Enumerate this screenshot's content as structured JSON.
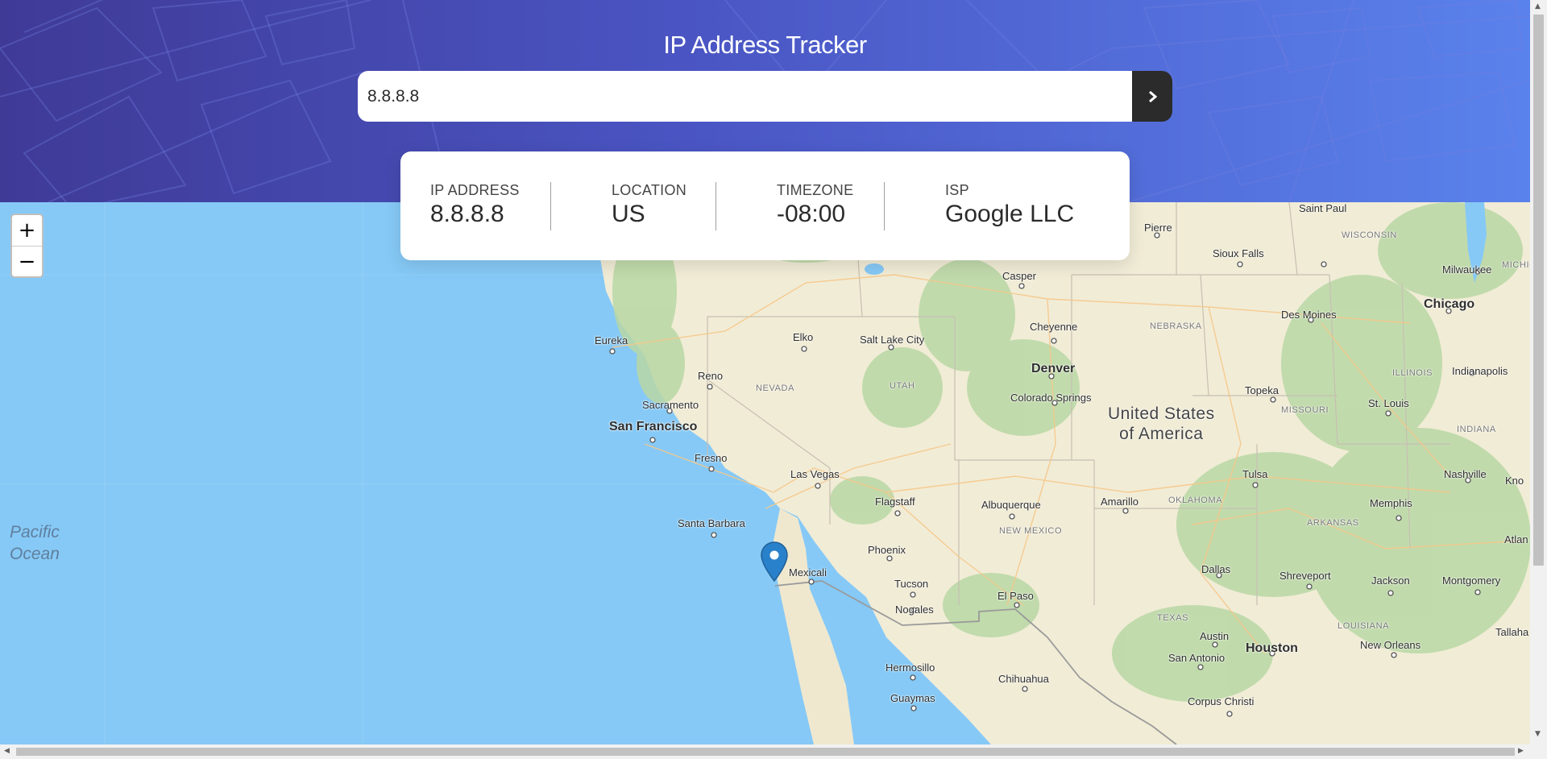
{
  "app": {
    "title": "IP Address Tracker"
  },
  "search": {
    "value": "8.8.8.8",
    "button_icon": "chevron-right-icon"
  },
  "info": [
    {
      "label": "IP ADDRESS",
      "value": "8.8.8.8"
    },
    {
      "label": "LOCATION",
      "value": "US"
    },
    {
      "label": "TIMEZONE",
      "value": "-08:00"
    },
    {
      "label": "ISP",
      "value": "Google LLC"
    }
  ],
  "map": {
    "zoom_in_label": "+",
    "zoom_out_label": "−",
    "marker_icon": "map-pin-icon",
    "labels": {
      "saint_paul": "Saint Paul",
      "pierre": "Pierre",
      "sioux_falls": "Sioux Falls",
      "casper": "Casper",
      "milwaukee": "Milwaukee",
      "chicago": "Chicago",
      "des_moines": "Des Moines",
      "eureka": "Eureka",
      "elko": "Elko",
      "salt_lake_city": "Salt Lake City",
      "cheyenne": "Cheyenne",
      "reno": "Reno",
      "denver": "Denver",
      "sacramento": "Sacramento",
      "colorado_springs": "Colorado Springs",
      "san_francisco": "San Francisco",
      "topeka": "Topeka",
      "st_louis": "St. Louis",
      "indianapolis": "Indianapolis",
      "fresno": "Fresno",
      "las_vegas": "Las Vegas",
      "tulsa": "Tulsa",
      "nashville": "Nashville",
      "flagstaff": "Flagstaff",
      "albuquerque": "Albuquerque",
      "amarillo": "Amarillo",
      "memphis": "Memphis",
      "santa_barbara": "Santa Barbara",
      "phoenix": "Phoenix",
      "mexicali": "Mexicali",
      "tucson": "Tucson",
      "el_paso": "El Paso",
      "nogales": "Nogales",
      "dallas": "Dallas",
      "shreveport": "Shreveport",
      "jackson": "Jackson",
      "montgomery": "Montgomery",
      "austin": "Austin",
      "houston": "Houston",
      "san_antonio": "San Antonio",
      "new_orleans": "New Orleans",
      "hermosillo": "Hermosillo",
      "chihuahua": "Chihuahua",
      "guaymas": "Guaymas",
      "corpus_christi": "Corpus Christi",
      "tallaha": "Tallaha",
      "atlan": "Atlan",
      "kno": "Kno",
      "united_states_l1": "United States",
      "united_states_l2": "of America",
      "pacific_l1": "Pacific",
      "pacific_l2": "Ocean",
      "wisconsin": "WISCONSIN",
      "michigan": "MICHIGA",
      "nebraska": "NEBRASKA",
      "nevada": "NEVADA",
      "utah": "UTAH",
      "illinois": "ILLINOIS",
      "indiana": "INDIANA",
      "missouri": "MISSOURI",
      "oklahoma": "OKLAHOMA",
      "arkansas": "ARKANSAS",
      "new_mexico": "NEW MEXICO",
      "texas": "TEXAS",
      "louisiana": "LOUISIANA"
    }
  },
  "colors": {
    "header_start": "#3f3a96",
    "header_end": "#5a82ec",
    "water": "#86c9f6",
    "land": "#f1ecd6",
    "dark_button": "#2b2b2b",
    "marker": "#2a81cb"
  }
}
